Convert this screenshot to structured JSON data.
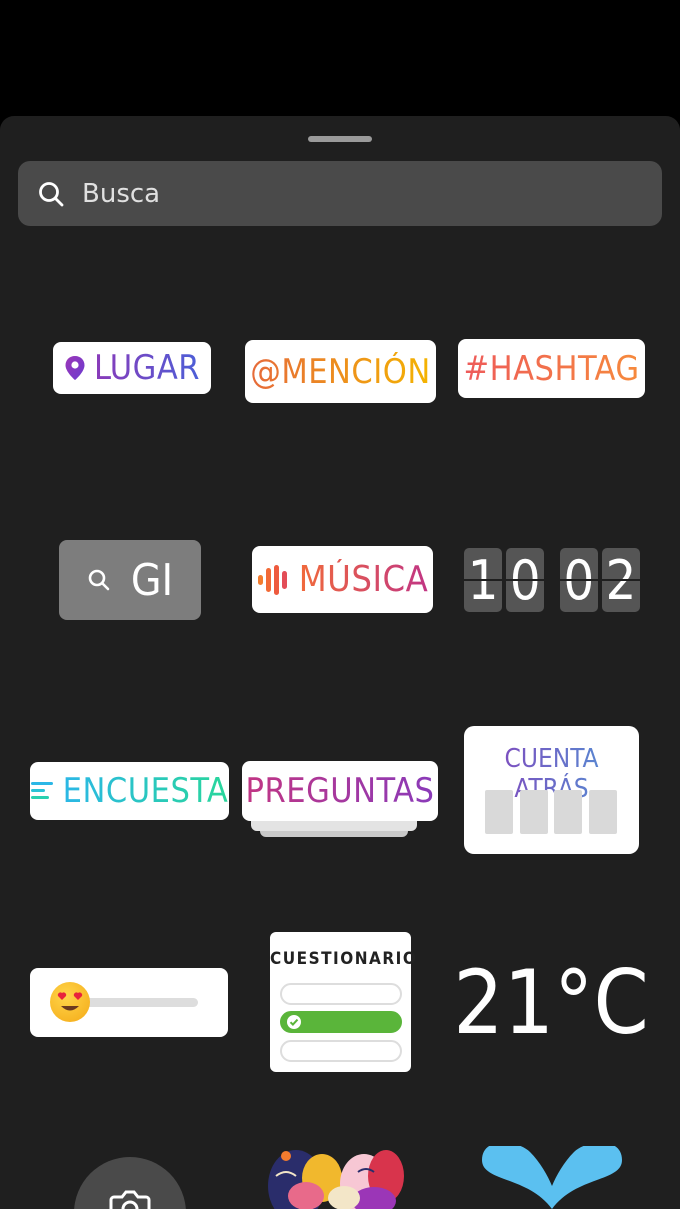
{
  "search": {
    "placeholder": "Busca"
  },
  "stickers": {
    "location": {
      "label": "LUGAR",
      "icon": "location-pin-icon"
    },
    "mention": {
      "label": "@MENCIÓN"
    },
    "hashtag": {
      "label": "#HASHTAG"
    },
    "gif": {
      "label": "GI",
      "icon": "search-icon"
    },
    "music": {
      "label": "MÚSICA",
      "icon": "audio-bars-icon"
    },
    "clock": {
      "d1": "1",
      "d2": "0",
      "d3": "0",
      "d4": "2"
    },
    "poll": {
      "label": "ENCUESTA",
      "icon": "poll-lines-icon"
    },
    "questions": {
      "label": "PREGUNTAS"
    },
    "countdown": {
      "label": "CUENTA ATRÁS"
    },
    "slider": {
      "icon": "heart-eyes-emoji-icon"
    },
    "quiz": {
      "label": "CUESTIONARIO",
      "icon": "checkmark-icon"
    },
    "temperature": {
      "label": "21°C"
    },
    "camera": {
      "icon": "camera-icon"
    }
  },
  "colors": {
    "sheet": "#1f1f1f",
    "search_bg": "#4a4a4a",
    "gif_bg": "#7d7d7d",
    "quiz_correct": "#5ab53a",
    "heart_blue": "#5bc0f0"
  }
}
